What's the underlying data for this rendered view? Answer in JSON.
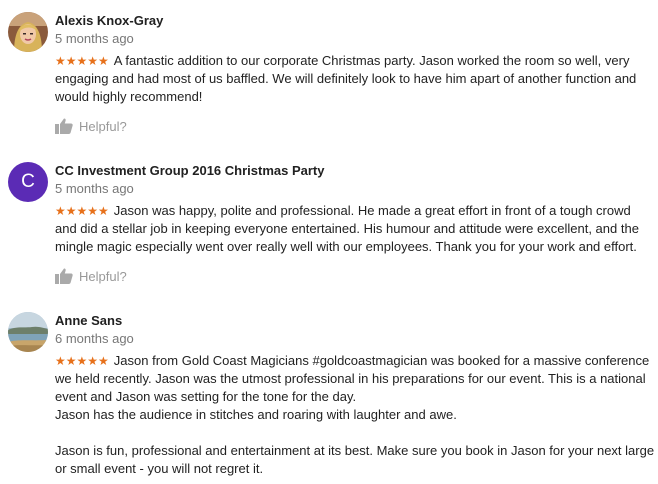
{
  "colors": {
    "star": "#e7711b",
    "avatar_letter_bg": "#5b2bb5",
    "muted": "#999999"
  },
  "reviews": [
    {
      "author": "Alexis Knox-Gray",
      "date": "5 months ago",
      "rating": 5,
      "stars": "★★★★★",
      "avatar_icon": "user-photo-icon",
      "paragraphs": [
        "A fantastic addition to our corporate Christmas party. Jason worked the room so well, very engaging and had most of us baffled. We will definitely look to have him apart of another function and would highly recommend!"
      ],
      "helpful_label": "Helpful?"
    },
    {
      "author": "CC Investment Group 2016 Christmas Party",
      "date": "5 months ago",
      "rating": 5,
      "stars": "★★★★★",
      "avatar_letter": "C",
      "paragraphs": [
        "Jason was happy, polite and professional. He made a great effort in front of a tough crowd and did a stellar job in keeping everyone entertained. His humour and attitude were excellent, and the mingle magic especially went over really well with our employees. Thank you for your work and effort."
      ],
      "helpful_label": "Helpful?"
    },
    {
      "author": "Anne Sans",
      "date": "6 months ago",
      "rating": 5,
      "stars": "★★★★★",
      "avatar_icon": "landscape-photo-icon",
      "paragraphs": [
        "Jason from Gold Coast Magicians #goldcoastmagician was booked for a massive conference we held recently. Jason was the utmost professional in his preparations for our event. This is a national event and Jason was setting for the tone for the day.",
        "Jason has the audience in stitches and roaring with laughter and awe.",
        "Jason is fun, professional and entertainment at its best. Make sure you book in Jason for your next large or small event - you will not regret it."
      ]
    }
  ]
}
